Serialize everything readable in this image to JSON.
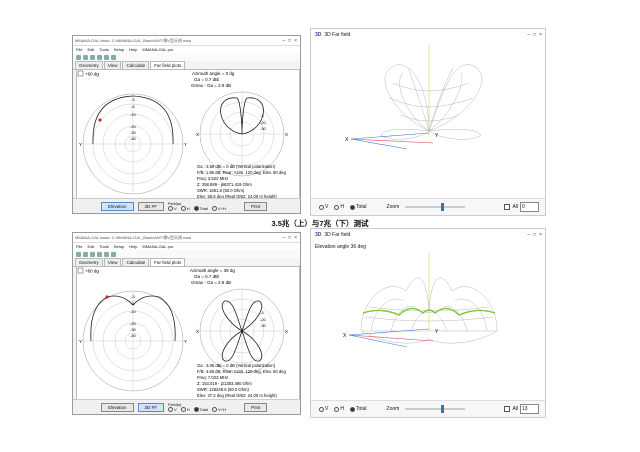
{
  "caption": "3.5兆（上）与7兆（下）测试",
  "top": {
    "mmana": {
      "title": "MMANA-GAL basic: C:\\MMANA-GAL_Basic\\ANT\\倒V型天线.maa",
      "menu": [
        "File",
        "Edit",
        "Tools",
        "Setup",
        "Help",
        "MMANA-GAL pro"
      ],
      "tabs": [
        "Geometry",
        "View",
        "Calculate",
        "Far field plots"
      ],
      "checkbox_label": "+60 dg",
      "azimuth_angle": "Azimuth angle = 0 dg",
      "ga": "Ga = 0.7 dBi",
      "gmax": "Gmax - Ga = 2.9 dB",
      "elev_ticks": [
        "-3",
        "-6",
        "-10",
        "-20",
        "-30",
        "-40"
      ],
      "azim_ticks": [
        "-3",
        "-6",
        "-10",
        "-20",
        "-30",
        "-40"
      ],
      "axis_x": "X",
      "axis_y": "Y",
      "axis_z": "Z",
      "info": [
        "Ga : 3.58 dBi = 0 dB (Vertical polarization)",
        "F/B: 1.86 dB; Rear: Azim. 120 deg,  Elev. 60 deg",
        "Freq: 3.523 MHz",
        "Z: 258.889 - j66371.419 Ohm",
        "SWR: 1651.6 (50.0 Ohm)",
        "Elev: 55.8 deg (Real GND:  24.00 m height)"
      ],
      "buttons": {
        "elevation": "Elevation",
        "ff3d": "3D FF",
        "print": "Print"
      },
      "field_label": "Field(s)",
      "radios": [
        "V",
        "H",
        "Total",
        "V+H"
      ],
      "selected_radio": "Total",
      "selected_button": "elevation"
    },
    "ff": {
      "title": "3D Far field",
      "badge": "3D",
      "elevation_text": "",
      "radios": [
        "V",
        "H",
        "Total"
      ],
      "selected_radio": "Total",
      "zoom_label": "Zoom",
      "zoom_level": 0.6,
      "all_label": "All",
      "spin_value": "0",
      "axis_x": "X",
      "axis_y": "Y"
    }
  },
  "bottom": {
    "mmana": {
      "title": "MMANA-GAL basic: C:\\MMANA-GAL_Basic\\ANT\\倒V型天线.maa",
      "menu": [
        "File",
        "Edit",
        "Tools",
        "Setup",
        "Help",
        "MMANA-GAL pro"
      ],
      "tabs": [
        "Geometry",
        "View",
        "Calculate",
        "Far field plots"
      ],
      "checkbox_label": "+60 dg",
      "azimuth_angle": "Azimuth angle = 39 dg",
      "ga": "Ga = 0.7 dBi",
      "gmax": "Gmax - Ga = 2.9 dB",
      "elev_ticks": [
        "-3",
        "-6",
        "-10",
        "-20",
        "-30",
        "-40"
      ],
      "azim_ticks": [
        "-3",
        "-6",
        "-10",
        "-20",
        "-30",
        "-40"
      ],
      "axis_x": "X",
      "axis_y": "Y",
      "axis_z": "Z",
      "info": [
        "Ga : 3.06 dBi = 0 dB (Vertical polarization)",
        "F/B: 4.68 dB; Rear: Azim. 120 deg,  Elev. 60 deg",
        "Freq: 7.023 MHz",
        "Z: 153.019 - j21383.480 Ohm",
        "SWR: 128248.5 (50.0 Ohm)",
        "Elev: 37.2 deg (Real GND:  24.00 m height)"
      ],
      "buttons": {
        "elevation": "Elevation",
        "ff3d": "3D FF",
        "print": "Print"
      },
      "field_label": "Field(s)",
      "radios": [
        "V",
        "H",
        "Total",
        "V+H"
      ],
      "selected_radio": "Total",
      "selected_button": "ff3d"
    },
    "ff": {
      "title": "3D Far field",
      "badge": "3D",
      "elevation_text": "Elevation angle 36 deg",
      "radios": [
        "V",
        "H",
        "Total"
      ],
      "selected_radio": "Total",
      "zoom_label": "Zoom",
      "zoom_level": 0.6,
      "all_label": "All",
      "spin_value": "13",
      "axis_x": "X",
      "axis_y": "Y"
    }
  },
  "colors": {
    "lobe_wire": "#b8b8b8",
    "lobe_highlight": "#7cc63a",
    "pattern": "#222222",
    "marker": "#e02020",
    "axis_blue": "#3a78d8",
    "axis_red": "#e04848",
    "axis_yellow": "#e0d040"
  }
}
